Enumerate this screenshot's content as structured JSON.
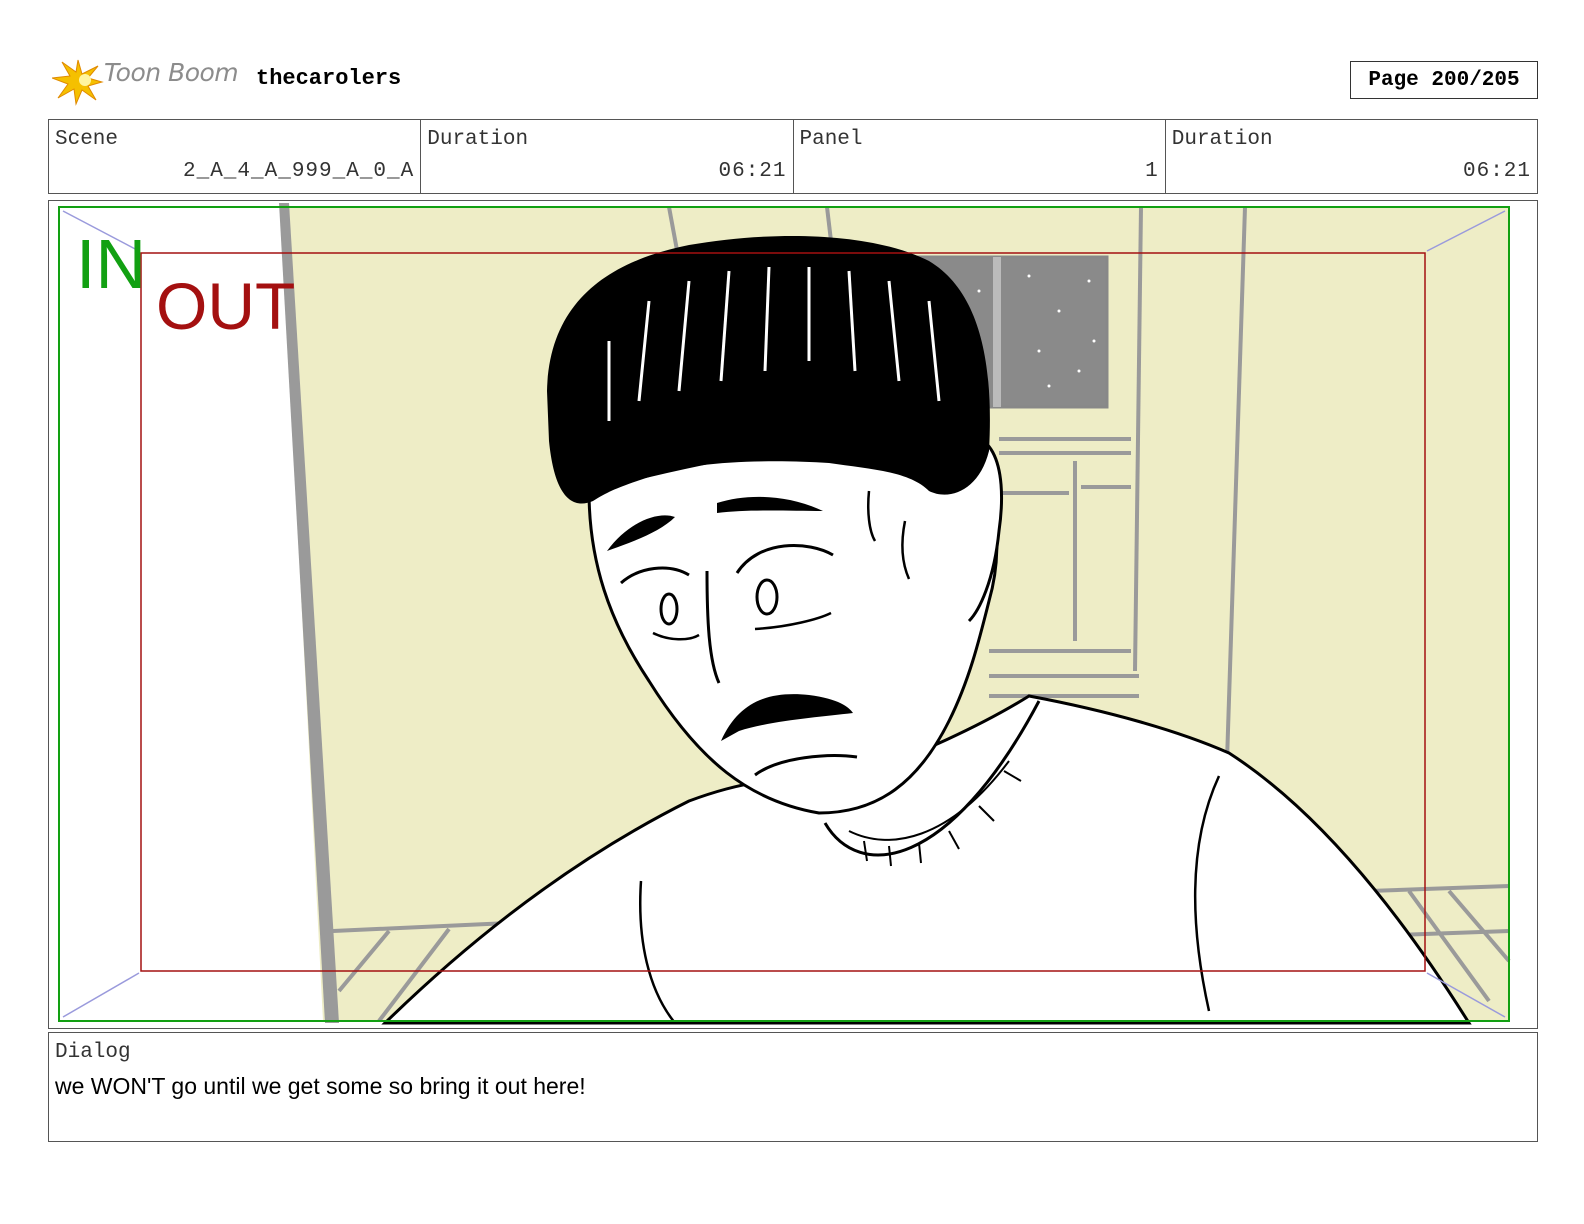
{
  "header": {
    "logo_text": "Toon Boom",
    "project_title": "thecarolers",
    "page_label": "Page 200/205"
  },
  "info": {
    "scene_label": "Scene",
    "scene_value": "2_A_4_A_999_A_0_A",
    "scene_duration_label": "Duration",
    "scene_duration_value": "06:21",
    "panel_label": "Panel",
    "panel_value": "1",
    "panel_duration_label": "Duration",
    "panel_duration_value": "06:21"
  },
  "panel": {
    "in_label": "IN",
    "out_label": "OUT",
    "in_frame_color": "#12a012",
    "out_frame_color": "#a41010",
    "background_color": "#eeedc6"
  },
  "dialog": {
    "label": "Dialog",
    "text": "we WON'T go until we get some so bring it out here!"
  }
}
